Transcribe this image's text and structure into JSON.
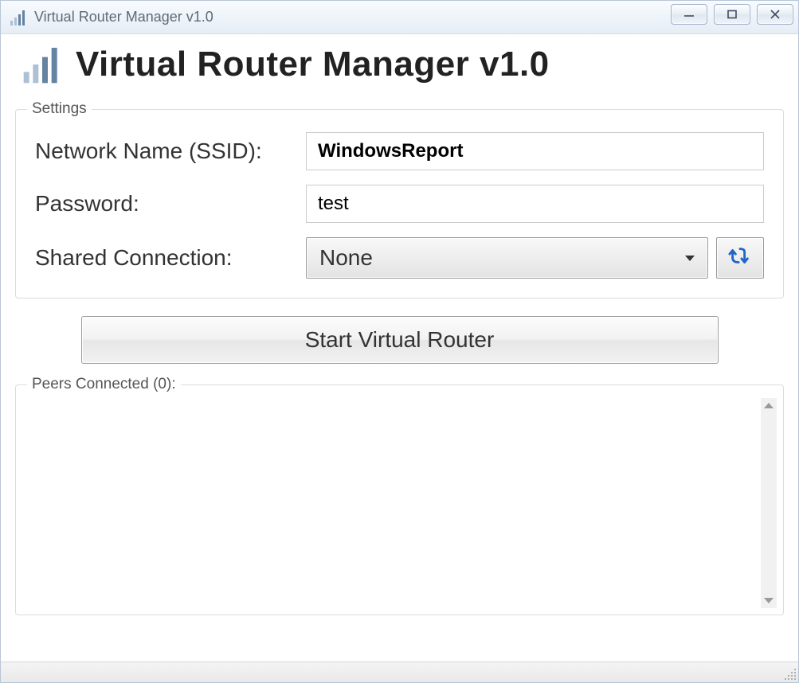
{
  "window": {
    "title": "Virtual Router Manager v1.0"
  },
  "header": {
    "title": "Virtual Router Manager v1.0",
    "icon": "signal-bars-icon"
  },
  "settings": {
    "legend": "Settings",
    "ssid_label": "Network Name (SSID):",
    "ssid_value": "WindowsReport",
    "password_label": "Password:",
    "password_value": "test",
    "shared_label": "Shared Connection:",
    "shared_value": "None",
    "refresh_icon": "refresh-arrows-icon"
  },
  "actions": {
    "start_label": "Start Virtual Router"
  },
  "peers": {
    "count": 0,
    "legend": "Peers Connected (0):",
    "items": []
  }
}
